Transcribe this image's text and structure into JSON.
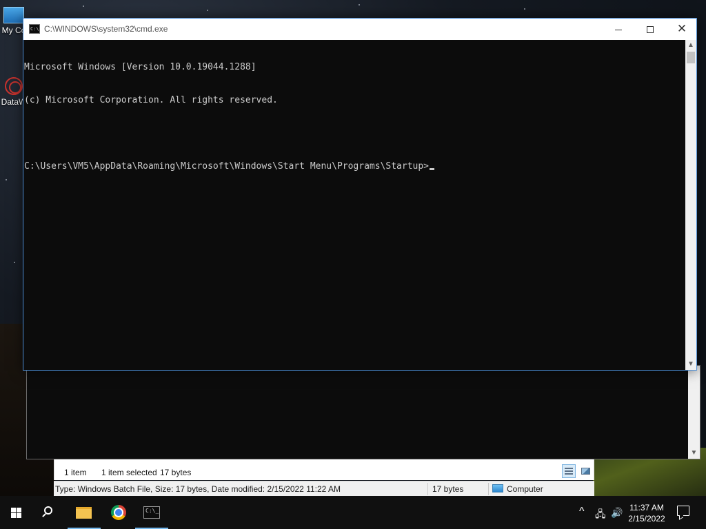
{
  "desktop": {
    "icons": [
      {
        "label": "My Co",
        "icon": "this-pc-icon"
      },
      {
        "label": "DataW",
        "icon": "datawrangler-shortcut-icon"
      }
    ]
  },
  "cmd_window": {
    "title": "C:\\WINDOWS\\system32\\cmd.exe",
    "lines": [
      "Microsoft Windows [Version 10.0.19044.1288]",
      "(c) Microsoft Corporation. All rights reserved.",
      "",
      "C:\\Users\\VM5\\AppData\\Roaming\\Microsoft\\Windows\\Start Menu\\Programs\\Startup>"
    ],
    "buttons": {
      "minimize": "minimize-icon",
      "maximize": "maximize-icon",
      "close": "✕"
    }
  },
  "explorer": {
    "status": {
      "item_count": "1 item",
      "selected": "1 item selected",
      "size": "17 bytes"
    },
    "details_bar": {
      "info": "Type: Windows Batch File, Size: 17 bytes, Date modified: 2/15/2022 11:22 AM",
      "size": "17 bytes",
      "location": "Computer"
    }
  },
  "taskbar": {
    "apps": [
      "start",
      "search",
      "file-explorer",
      "chrome",
      "command-prompt"
    ],
    "tray": {
      "chevron": "^",
      "time": "11:37 AM",
      "date": "2/15/2022"
    }
  }
}
